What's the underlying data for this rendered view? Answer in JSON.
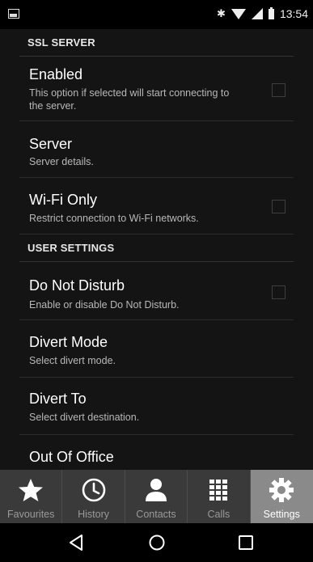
{
  "status_bar": {
    "time": "13:54",
    "icons": [
      "notification-icon",
      "bluetooth-icon",
      "wifi-icon",
      "signal-icon",
      "battery-icon"
    ]
  },
  "sections": {
    "ssl": {
      "header": "SSL SERVER"
    },
    "user": {
      "header": "USER SETTINGS"
    }
  },
  "prefs": {
    "enabled": {
      "title": "Enabled",
      "summary": "This option if selected will start connecting to the server.",
      "checked": false
    },
    "server": {
      "title": "Server",
      "summary": "Server details."
    },
    "wifi_only": {
      "title": "Wi-Fi Only",
      "summary": "Restrict connection to Wi-Fi networks.",
      "checked": false
    },
    "dnd": {
      "title": "Do Not Disturb",
      "summary": "Enable or disable Do Not Disturb.",
      "checked": false
    },
    "divert_mode": {
      "title": "Divert Mode",
      "summary": "Select divert mode."
    },
    "divert_to": {
      "title": "Divert To",
      "summary": "Select divert destination."
    },
    "out_of_office": {
      "title": "Out Of Office"
    }
  },
  "tabs": {
    "favourites": "Favourites",
    "history": "History",
    "contacts": "Contacts",
    "calls": "Calls",
    "settings": "Settings",
    "active": "settings"
  },
  "colors": {
    "background": "#141414",
    "tabbar": "#3a3a3a",
    "active_tab": "#8a8a8a"
  }
}
